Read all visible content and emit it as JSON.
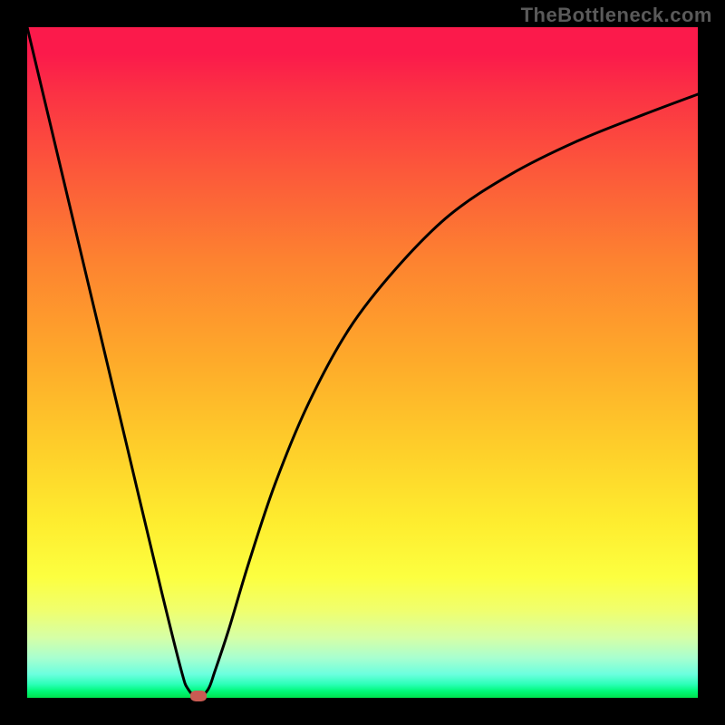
{
  "watermark": "TheBottleneck.com",
  "chart_data": {
    "type": "line",
    "title": "",
    "xlabel": "",
    "ylabel": "",
    "xlim": [
      0,
      100
    ],
    "ylim": [
      0,
      100
    ],
    "grid": false,
    "series": [
      {
        "name": "curve",
        "x": [
          0,
          5,
          10,
          15,
          20,
          23,
          24,
          25.5,
          27,
          28,
          30,
          33,
          37,
          42,
          48,
          55,
          63,
          72,
          82,
          92,
          100
        ],
        "values": [
          100,
          79,
          58,
          37,
          16,
          4,
          1.3,
          0,
          1.3,
          4,
          10,
          20,
          32,
          44,
          55,
          64,
          72,
          78,
          83,
          87,
          90
        ]
      }
    ],
    "vertex": {
      "x": 25.5,
      "y": 0
    },
    "background_gradient": {
      "orientation": "vertical_top_to_bottom",
      "stops": [
        {
          "y": 100,
          "color": "#fb1a4b"
        },
        {
          "y": 50,
          "color": "#feab2a"
        },
        {
          "y": 18,
          "color": "#fcff40"
        },
        {
          "y": 4,
          "color": "#6bffde"
        },
        {
          "y": 0,
          "color": "#00e24e"
        }
      ]
    },
    "marker": {
      "shape": "ellipse",
      "color": "#c95b53",
      "at": "vertex"
    }
  }
}
